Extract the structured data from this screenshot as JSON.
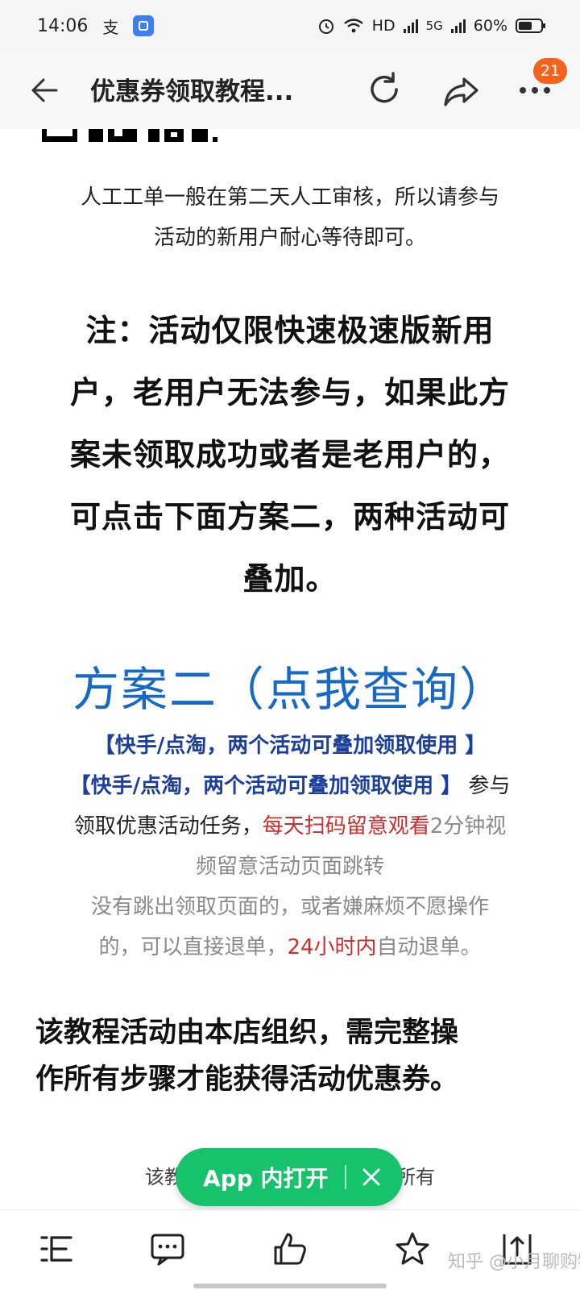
{
  "status_bar": {
    "time": "14:06",
    "left_glyph": "支",
    "network": "HD",
    "signal_5g": "5G",
    "battery": "60%"
  },
  "toolbar": {
    "title": "优惠券领取教程...",
    "badge": "21",
    "icons": [
      "back-arrow-icon",
      "refresh-icon",
      "share-icon",
      "more-icon"
    ]
  },
  "article": {
    "para1_line1": "人工工单一般在第二天人工审核，所以请参与",
    "para1_line2": "活动的新用户耐心等待即可。",
    "note_line1": "注：活动仅限快速极速版新用",
    "note_line2": "户，老用户无法参与，如果此方",
    "note_line3": "案未领取成功或者是老用户的，",
    "note_line4": "可点击下面方案二，两种活动可",
    "note_line5": "叠加。",
    "plan_title": "方案二（点我查询）",
    "tag_line": "【快手/点淘，两个活动可叠加领取使用 】",
    "task_tag": "【快手/点淘，两个活动可叠加领取使用 】",
    "task_join": " 参与",
    "task_line2_a": "领取优惠活动任务，",
    "task_line2_red": "每天扫码留意观看",
    "task_line2_b": "2分钟视",
    "task_line3": "频留意活动页面跳转",
    "refund_line1": "没有跳出领取页面的，或者嫌麻烦不愿操作",
    "refund_line2_a": "的，可以直接退单，",
    "refund_line2_red": "24小时内",
    "refund_line2_b": "自动退单。",
    "closing_line1": "该教程活动由本店组织，需完整操",
    "closing_line2": "作所有步骤才能获得活动优惠券。",
    "faded_partial": "该教程活动最终解释权归本店所有"
  },
  "app_pill": {
    "label": "App 内打开"
  },
  "bottom_bar": {
    "icons": [
      "catalog-icon",
      "comment-icon",
      "like-icon",
      "star-icon",
      "share-up-icon"
    ],
    "watermark": "知乎 @小月聊购物"
  },
  "colors": {
    "link_blue": "#1769c6",
    "tag_blue": "#1c3f9b",
    "highlight_red": "#d12b2b",
    "pill_green": "#16c26b",
    "badge_orange": "#f2631e"
  }
}
